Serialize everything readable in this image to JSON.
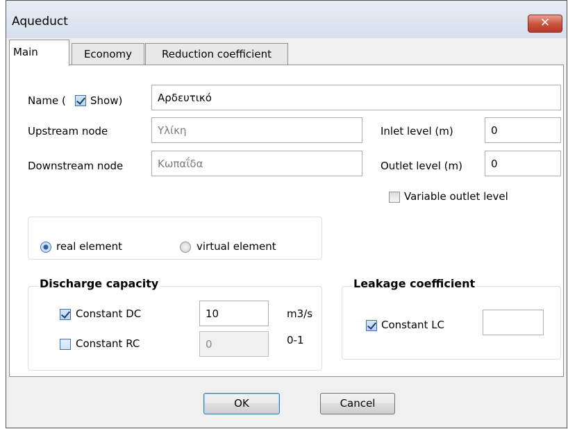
{
  "window": {
    "title": "Aqueduct",
    "close_glyph": "✕"
  },
  "tabs": [
    {
      "label": "Main",
      "active": true
    },
    {
      "label": "Economy",
      "active": false
    },
    {
      "label": "Reduction coefficient",
      "active": false
    }
  ],
  "main": {
    "name_label_prefix": "Name (",
    "show_label": "Show)",
    "show_checked": true,
    "name_value": "Αρδευτικό",
    "upstream_label": "Upstream node",
    "upstream_value": "Υλίκη",
    "downstream_label": "Downstream node",
    "downstream_value": "Κωπαΐδα",
    "inlet_label": "Inlet level (m)",
    "inlet_value": "0",
    "outlet_label": "Outlet level (m)",
    "outlet_value": "0",
    "variable_outlet_label": "Variable outlet level",
    "variable_outlet_checked": false,
    "element_type": {
      "real_label": "real element",
      "virtual_label": "virtual element",
      "selected": "real element"
    },
    "discharge": {
      "title": "Discharge capacity",
      "constant_dc_label": "Constant DC",
      "constant_dc_checked": true,
      "dc_value": "10",
      "dc_unit": "m3/s",
      "constant_rc_label": "Constant RC",
      "constant_rc_checked": false,
      "rc_value": "0",
      "rc_unit": "0-1"
    },
    "leakage": {
      "title": "Leakage coefficient",
      "constant_lc_label": "Constant LC",
      "constant_lc_checked": true,
      "lc_value": ""
    }
  },
  "buttons": {
    "ok": "OK",
    "cancel": "Cancel"
  },
  "colors": {
    "accent": "#3c6fb0",
    "close": "#c7513b"
  }
}
